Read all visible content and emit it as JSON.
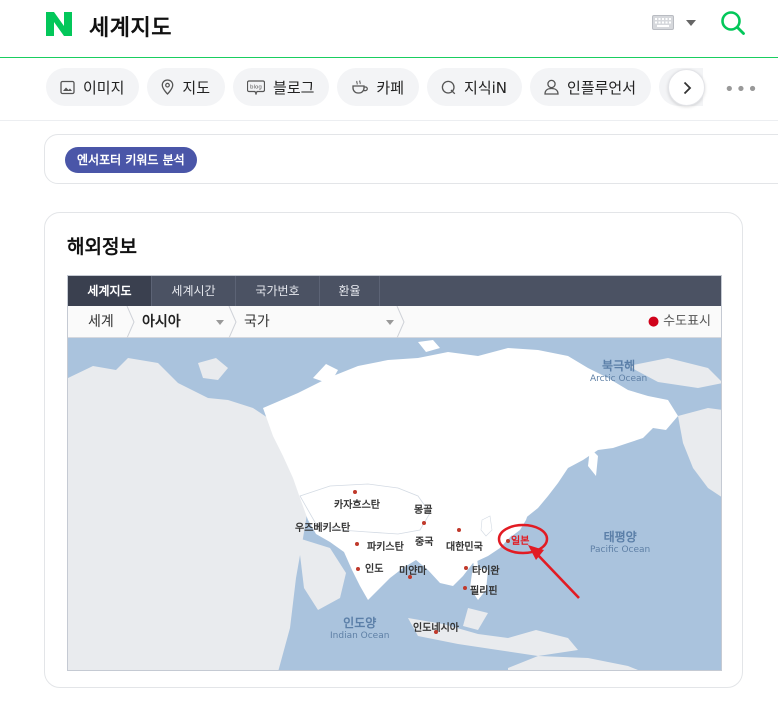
{
  "header": {
    "title": "세계지도"
  },
  "tabs": [
    {
      "label": "이미지",
      "icon": "image-icon"
    },
    {
      "label": "지도",
      "icon": "map-pin-icon"
    },
    {
      "label": "블로그",
      "icon": "blog-icon"
    },
    {
      "label": "카페",
      "icon": "cafe-icon"
    },
    {
      "label": "지식iN",
      "icon": "knowledge-icon"
    },
    {
      "label": "인플루언서",
      "icon": "person-icon"
    }
  ],
  "keyword_tag": "엔서포터 키워드 분석",
  "section": {
    "title": "해외정보"
  },
  "widget": {
    "tabs": [
      "세계지도",
      "세계시간",
      "국가번호",
      "환율"
    ],
    "breadcrumb": {
      "world": "세계",
      "region": "아시아",
      "country": "국가"
    },
    "capital_toggle": "수도표시"
  },
  "map": {
    "countries": [
      "카자흐스탄",
      "몽골",
      "우즈베키스탄",
      "파키스탄",
      "중국",
      "대한민국",
      "일본",
      "인도",
      "미얀마",
      "타이완",
      "필리핀",
      "인도네시아"
    ],
    "oceans": [
      {
        "ko": "북극해",
        "en": "Arctic Ocean"
      },
      {
        "ko": "태평양",
        "en": "Pacific Ocean"
      },
      {
        "ko": "인도양",
        "en": "Indian Ocean"
      }
    ]
  },
  "colors": {
    "accent": "#19ce60",
    "keyword_pill": "#4a56a8",
    "highlight": "#e21b23",
    "sea": "#aac3dd"
  }
}
